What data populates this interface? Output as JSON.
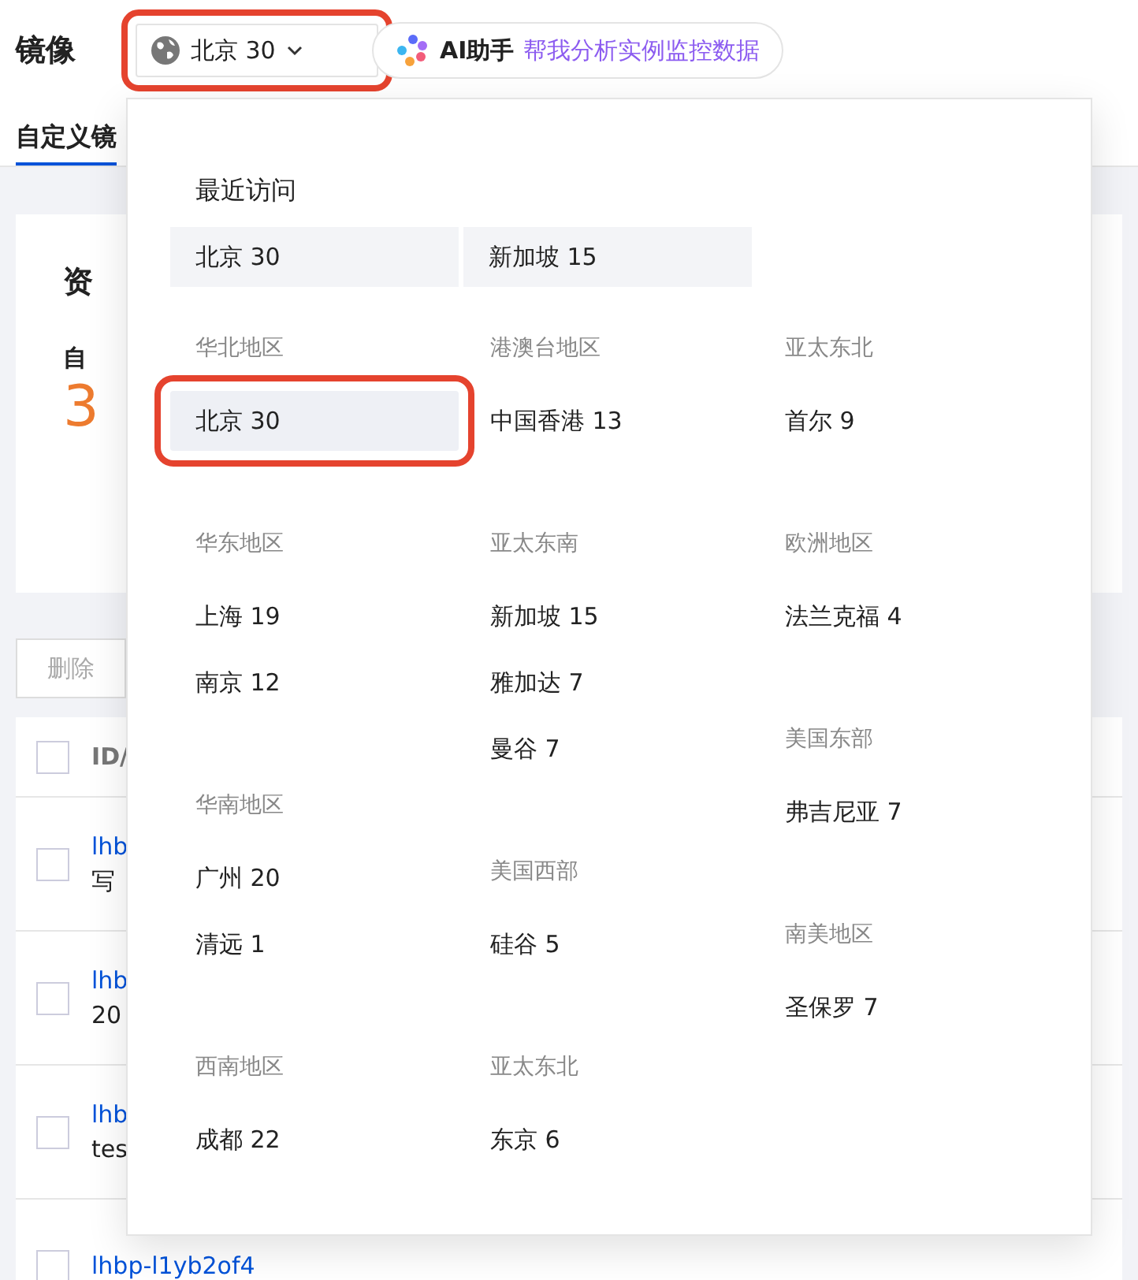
{
  "page_title": "镜像",
  "region_selector": {
    "label": "北京 30",
    "annotated": true
  },
  "ai_assistant": {
    "name": "AI助手",
    "prompt": "帮我分析实例监控数据"
  },
  "tabs": [
    {
      "label": "自定义镜",
      "selected": true
    }
  ],
  "summary_card": {
    "title": "资",
    "stat_label": "自",
    "stat_value": "3"
  },
  "toolbar": {
    "buttons": [
      "删除"
    ]
  },
  "table": {
    "columns": [
      "ID/"
    ],
    "all_checked": false,
    "rows": [
      {
        "id": "lhb",
        "name": "写",
        "checked": false
      },
      {
        "id": "lhb",
        "name": "20",
        "checked": false
      },
      {
        "id": "lhb",
        "name": "tes",
        "checked": false
      },
      {
        "id": "lhbp-l1yb2of4",
        "checked": false
      }
    ]
  },
  "region_dropdown": {
    "recent_title": "最近访问",
    "recent": [
      {
        "label": "北京 30"
      },
      {
        "label": "新加坡 15"
      }
    ],
    "columns": [
      [
        {
          "title": "华北地区",
          "items": [
            {
              "label": "北京 30",
              "selected": true,
              "annotated": true
            }
          ]
        },
        {
          "title": "华东地区",
          "items": [
            {
              "label": "上海 19",
              "selected": false,
              "annotated": false
            },
            {
              "label": "南京 12",
              "selected": false,
              "annotated": false
            }
          ]
        },
        {
          "title": "华南地区",
          "items": [
            {
              "label": "广州 20",
              "selected": false,
              "annotated": false
            },
            {
              "label": "清远 1",
              "selected": false,
              "annotated": false
            }
          ]
        },
        {
          "title": "西南地区",
          "items": [
            {
              "label": "成都 22",
              "selected": false,
              "annotated": false
            }
          ]
        }
      ],
      [
        {
          "title": "港澳台地区",
          "items": [
            {
              "label": "中国香港 13",
              "selected": false,
              "annotated": false
            }
          ]
        },
        {
          "title": "亚太东南",
          "items": [
            {
              "label": "新加坡 15",
              "selected": false,
              "annotated": false
            },
            {
              "label": "雅加达 7",
              "selected": false,
              "annotated": false
            },
            {
              "label": "曼谷 7",
              "selected": false,
              "annotated": false
            }
          ]
        },
        {
          "title": "美国西部",
          "items": [
            {
              "label": "硅谷 5",
              "selected": false,
              "annotated": false
            }
          ]
        },
        {
          "title": "亚太东北",
          "items": [
            {
              "label": "东京 6",
              "selected": false,
              "annotated": false
            }
          ]
        }
      ],
      [
        {
          "title": "亚太东北",
          "items": [
            {
              "label": "首尔 9",
              "selected": false,
              "annotated": false
            }
          ]
        },
        {
          "title": "欧洲地区",
          "items": [
            {
              "label": "法兰克福 4",
              "selected": false,
              "annotated": false
            }
          ]
        },
        {
          "title": "美国东部",
          "items": [
            {
              "label": "弗吉尼亚 7",
              "selected": false,
              "annotated": false
            }
          ]
        },
        {
          "title": "南美地区",
          "items": [
            {
              "label": "圣保罗 7",
              "selected": false,
              "annotated": false
            }
          ]
        }
      ]
    ]
  }
}
